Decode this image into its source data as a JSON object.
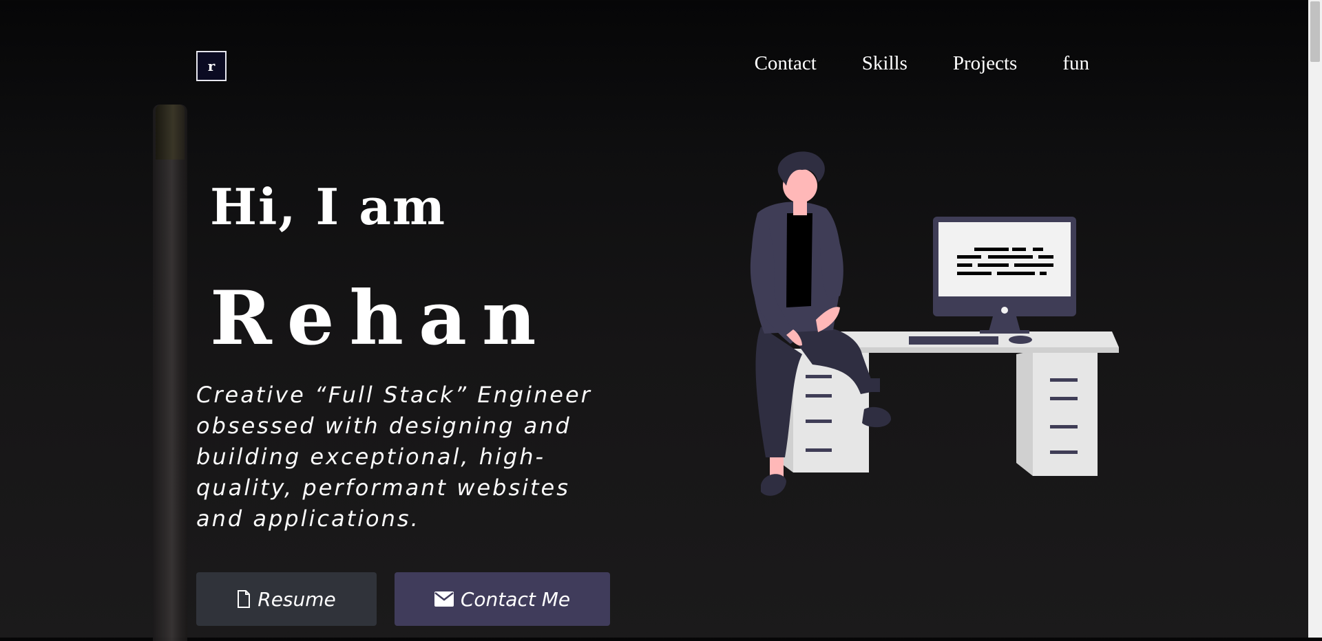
{
  "logo": {
    "letter": "r"
  },
  "nav": {
    "items": [
      {
        "label": "Contact"
      },
      {
        "label": "Skills"
      },
      {
        "label": "Projects"
      },
      {
        "label": "fun"
      }
    ]
  },
  "hero": {
    "greeting": "Hi, I am",
    "name": "Rehan",
    "tagline": "Creative “Full Stack” Engineer obsessed with designing and building exceptional, high-quality, performant websites and applications."
  },
  "buttons": {
    "resume_label": "Resume",
    "contact_label": "Contact Me"
  },
  "icons": {
    "resume": "file-icon",
    "contact": "envelope-icon"
  },
  "colors": {
    "resume_button": "#30333a",
    "contact_button": "#403c5b",
    "illustration_dark": "#2f2e41",
    "skin": "#ffb8b8",
    "desk": "#e6e6e6"
  }
}
